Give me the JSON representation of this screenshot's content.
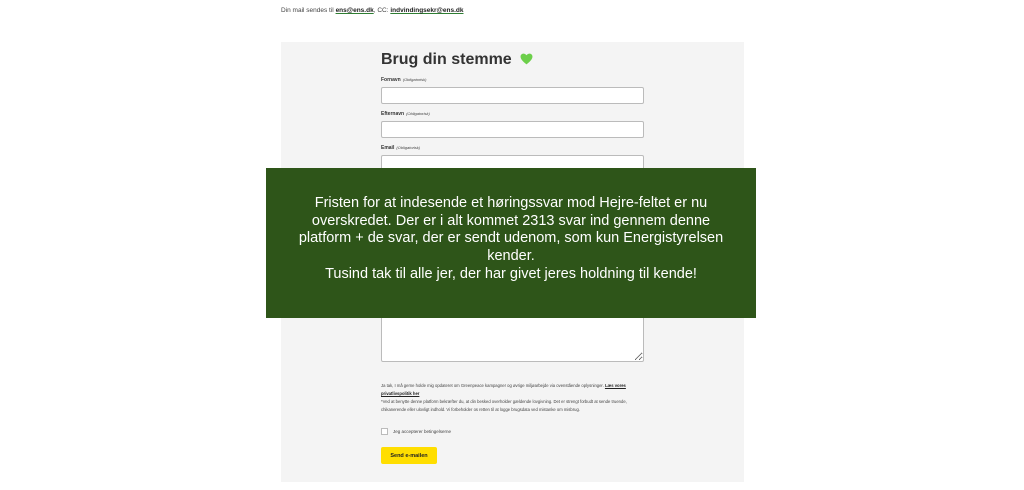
{
  "mail_info": {
    "prefix": "Din mail sendes til",
    "to": "ens@ens.dk",
    "cc_label": ", CC:",
    "cc": "indvindingsekr@ens.dk"
  },
  "form": {
    "title": "Brug din stemme",
    "title_icon": "green-heart-icon",
    "fields": [
      {
        "label": "Fornavn",
        "required": "(Obligatorisk)",
        "value": "",
        "placeholder": ""
      },
      {
        "label": "Efternavn",
        "required": "(Obligatorisk)",
        "value": "",
        "placeholder": ""
      },
      {
        "label": "Email",
        "required": "(Obligatorisk)",
        "value": "",
        "placeholder": ""
      }
    ],
    "consent_text": "Ja tak, I må gerne holde mig opdateret om Greenpeace kampagner og øvrige miljøarbejde via ovenstående oplysninger.",
    "privacy_link": "Læs vores privatlivspolitik her",
    "disclaimer": "*Ved at benytte denne platform bekræfter du, at din besked overholder gældende lovgivning. Det er strengt forbudt at sende truende, chikanerende eller ulovligt indhold. Vi forbeholder os retten til at logge brugsdata ved mistanke om misbrug.",
    "checkbox_label": "Jeg accepterer betingelserne",
    "send_label": "Send e-mailen"
  },
  "overlay": {
    "message": "Fristen for at indesende et høringssvar mod Hejre-feltet er nu overskredet. Der er i alt kommet 2313 svar ind gennem denne platform + de svar, der er sendt udenom, som kun Energistyrelsen kender.",
    "thanks": "Tusind tak til alle jer, der har givet jeres holdning til kende!"
  },
  "colors": {
    "overlay_bg": "#2e5519",
    "button_bg": "#ffde00",
    "heart": "#6ccf4a"
  }
}
